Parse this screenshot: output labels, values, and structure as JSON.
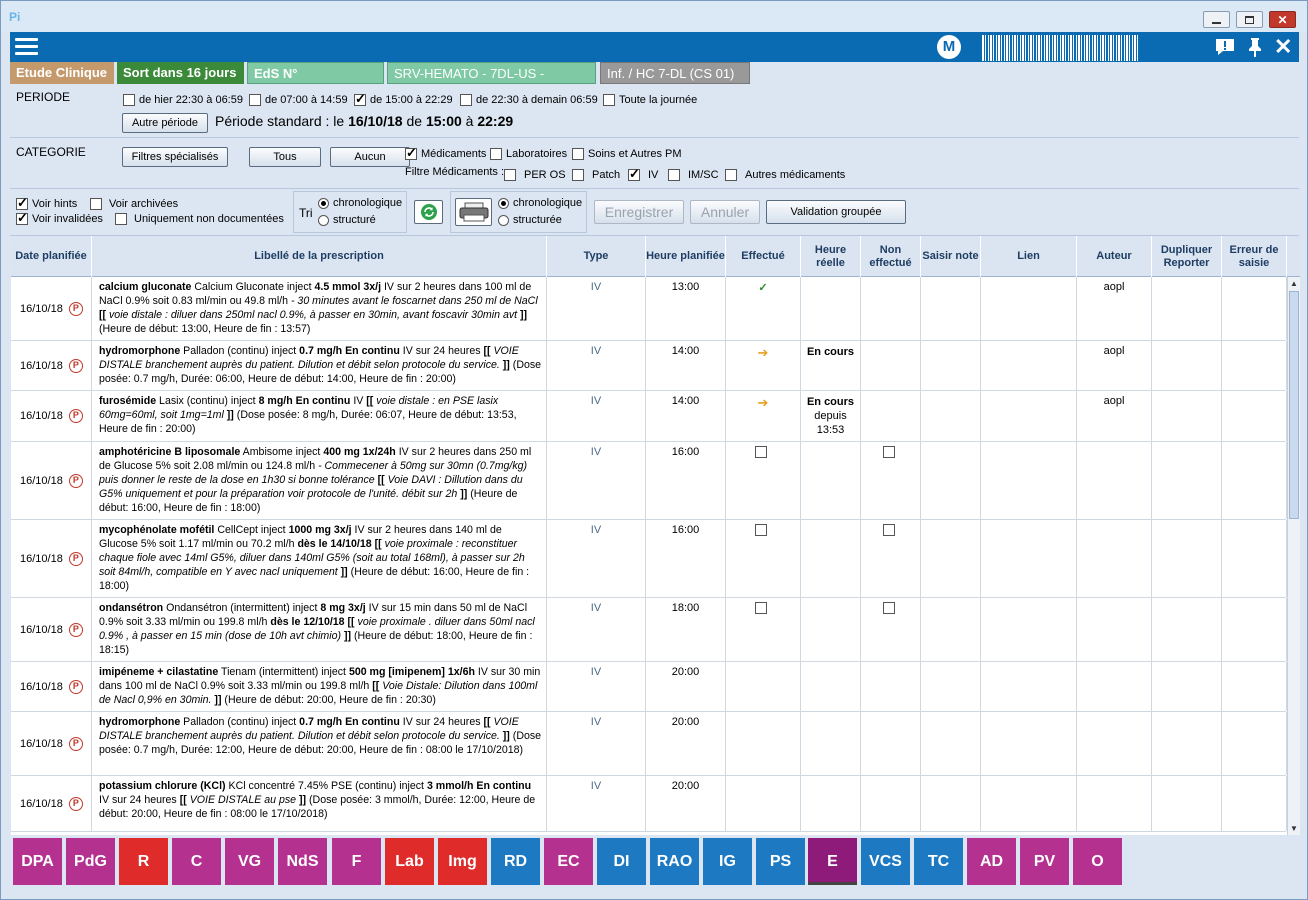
{
  "window": {
    "app_title": "Pi"
  },
  "tags": {
    "etude": "Etude Clinique",
    "sort": "Sort dans 16 jours",
    "eds": "EdS N°",
    "service": "SRV-HEMATO - 7DL-US -",
    "inf": "Inf. / HC 7-DL (CS 01)"
  },
  "header": {
    "user_initial": "M"
  },
  "periode": {
    "label": "PERIODE",
    "options": [
      {
        "label": "de hier 22:30 à 06:59",
        "checked": false
      },
      {
        "label": "de 07:00 à 14:59",
        "checked": false
      },
      {
        "label": "de 15:00 à 22:29",
        "checked": true
      },
      {
        "label": "de 22:30 à demain 06:59",
        "checked": false
      },
      {
        "label": "Toute la journée",
        "checked": false
      }
    ],
    "autre_btn": "Autre période",
    "std_prefix": "Période standard :  le ",
    "std_date": "16/10/18",
    "std_de": " de ",
    "std_start": "15:00",
    "std_a": " à ",
    "std_end": "22:29"
  },
  "categorie": {
    "label": "CATEGORIE",
    "btn_filtres": "Filtres spécialisés",
    "btn_tous": "Tous",
    "btn_aucun": "Aucun",
    "cat_options": [
      {
        "label": "Médicaments",
        "checked": true
      },
      {
        "label": "Laboratoires",
        "checked": false
      },
      {
        "label": "Soins et Autres PM",
        "checked": false
      }
    ],
    "filtre_label": "Filtre Médicaments :",
    "med_options": [
      {
        "label": "PER OS",
        "checked": false
      },
      {
        "label": "Patch",
        "checked": false
      },
      {
        "label": "IV",
        "checked": true
      },
      {
        "label": "IM/SC",
        "checked": false
      },
      {
        "label": "Autres médicaments",
        "checked": false
      }
    ]
  },
  "options": {
    "voir_hints": "Voir hints",
    "voir_archivees": "Voir archivées",
    "voir_invalidees": "Voir invalidées",
    "non_documentees": "Uniquement non documentées",
    "tri": "Tri",
    "chrono": "chronologique",
    "structure": "structuré",
    "chrono2": "chronologique",
    "structuree": "structurée",
    "enregistrer": "Enregistrer",
    "annuler": "Annuler",
    "validation": "Validation groupée"
  },
  "columns": [
    "Date planifiée",
    "Libellé de la prescription",
    "Type",
    "Heure planifiée",
    "Effectué",
    "Heure réelle",
    "Non effectué",
    "Saisir note",
    "Lien",
    "Auteur",
    "Dupliquer Reporter",
    "Erreur de saisie"
  ],
  "rows": [
    {
      "date": "16/10/18",
      "parts": [
        [
          "b",
          "calcium gluconate"
        ],
        [
          "n",
          " Calcium Gluconate inject  "
        ],
        [
          "b",
          "4.5 mmol  3x/j"
        ],
        [
          "n",
          " IV sur 2 heures dans 100 ml de NaCl 0.9% soit 0.83 ml/min ou 49.8 ml/h  "
        ],
        [
          "i",
          "- 30 minutes avant le foscarnet dans 250 ml de NaCl "
        ],
        [
          "b",
          "[["
        ],
        [
          "i",
          " voie distale : diluer dans 250ml nacl 0.9%, à passer en 30min, avant foscavir 30min avt "
        ],
        [
          "b",
          "]]"
        ],
        [
          "n",
          "  (Heure de début: 13:00, Heure de fin : 13:57)"
        ]
      ],
      "type": "IV",
      "heure": "13:00",
      "effectue": "check",
      "reelle": "",
      "reelle2": "",
      "non": false,
      "auteur": "aopl"
    },
    {
      "date": "16/10/18",
      "parts": [
        [
          "b",
          "hydromorphone"
        ],
        [
          "n",
          " Palladon (continu) inject  "
        ],
        [
          "b",
          "0.7 mg/h  En continu"
        ],
        [
          "n",
          " IV sur 24 heures "
        ],
        [
          "b",
          "[["
        ],
        [
          "i",
          " VOIE DISTALE branchement auprès du patient. Dilution et débit selon protocole du service. "
        ],
        [
          "b",
          "]]"
        ],
        [
          "n",
          " (Dose posée: 0.7 mg/h, Durée: 06:00, Heure de début: 14:00, Heure de fin : 20:00)"
        ]
      ],
      "type": "IV",
      "heure": "14:00",
      "effectue": "arrow",
      "reelle": "En cours",
      "reelle2": "",
      "non": false,
      "auteur": "aopl"
    },
    {
      "date": "16/10/18",
      "parts": [
        [
          "b",
          "furosémide"
        ],
        [
          "n",
          " Lasix (continu) inject  "
        ],
        [
          "b",
          "8 mg/h  En continu"
        ],
        [
          "n",
          " IV "
        ],
        [
          "b",
          "[["
        ],
        [
          "i",
          " voie distale : en PSE lasix 60mg=60ml, soit 1mg=1ml "
        ],
        [
          "b",
          "]]"
        ],
        [
          "n",
          "  (Dose posée: 8 mg/h, Durée: 06:07, Heure de début: 13:53, Heure de fin : 20:00)"
        ]
      ],
      "type": "IV",
      "heure": "14:00",
      "effectue": "arrow",
      "reelle": "En cours",
      "reelle2": "depuis 13:53",
      "non": false,
      "auteur": "aopl"
    },
    {
      "date": "16/10/18",
      "parts": [
        [
          "b",
          "amphotéricine B liposomale"
        ],
        [
          "n",
          " Ambisome inject  "
        ],
        [
          "b",
          "400 mg  1x/24h"
        ],
        [
          "n",
          " IV sur 2 heures dans 250 ml de Glucose 5% soit 2.08 ml/min ou 124.8 ml/h  "
        ],
        [
          "i",
          "- Commecener à 50mg sur 30mn (0.7mg/kg) puis donner le reste de la dose en 1h30 si bonne tolérance "
        ],
        [
          "b",
          "[["
        ],
        [
          "i",
          " Voie DAVI : Dillution dans du G5% uniquement et pour la préparation voir protocole de l'unité. débit sur 2h "
        ],
        [
          "b",
          "]]"
        ],
        [
          "n",
          "  (Heure de début: 16:00, Heure de fin : 18:00)"
        ]
      ],
      "type": "IV",
      "heure": "16:00",
      "effectue": "box",
      "reelle": "",
      "reelle2": "",
      "non": true,
      "auteur": ""
    },
    {
      "date": "16/10/18",
      "parts": [
        [
          "b",
          "mycophénolate mofétil"
        ],
        [
          "n",
          " CellCept inject  "
        ],
        [
          "b",
          "1000 mg  3x/j"
        ],
        [
          "n",
          " IV sur 2 heures dans 140 ml de Glucose 5% soit 1.17 ml/min ou 70.2 ml/h  "
        ],
        [
          "b",
          "dès le 14/10/18 [["
        ],
        [
          "i",
          " voie proximale : reconstituer chaque fiole avec 14ml G5%, diluer dans 140ml G5% (soit au total 168ml), à passer sur 2h soit 84ml/h, compatible en Y avec nacl uniquement "
        ],
        [
          "b",
          "]]"
        ],
        [
          "n",
          "  (Heure de début: 16:00, Heure de fin : 18:00)"
        ]
      ],
      "type": "IV",
      "heure": "16:00",
      "effectue": "box",
      "reelle": "",
      "reelle2": "",
      "non": true,
      "auteur": ""
    },
    {
      "date": "16/10/18",
      "parts": [
        [
          "b",
          "ondansétron"
        ],
        [
          "n",
          " Ondansétron (intermittent) inject  "
        ],
        [
          "b",
          "8 mg  3x/j"
        ],
        [
          "n",
          " IV sur 15 min dans 50 ml de NaCl 0.9% soit 3.33 ml/min ou 199.8 ml/h  "
        ],
        [
          "b",
          "dès le 12/10/18 [["
        ],
        [
          "i",
          " voie proximale . diluer dans 50ml nacl 0.9% , à passer en 15 min (dose de 10h avt chimio) "
        ],
        [
          "b",
          "]]"
        ],
        [
          "n",
          "  (Heure de début: 18:00, Heure de fin : 18:15)"
        ]
      ],
      "type": "IV",
      "heure": "18:00",
      "effectue": "box",
      "reelle": "",
      "reelle2": "",
      "non": true,
      "auteur": ""
    },
    {
      "date": "16/10/18",
      "parts": [
        [
          "b",
          "imipéneme + cilastatine"
        ],
        [
          "n",
          " Tienam (intermittent) inject  "
        ],
        [
          "b",
          "500 mg [imipenem]  1x/6h"
        ],
        [
          "n",
          " IV sur 30 min dans 100 ml de NaCl 0.9% soit 3.33 ml/min ou 199.8 ml/h "
        ],
        [
          "b",
          "[["
        ],
        [
          "i",
          " Voie Distale: Dilution dans 100ml de Nacl 0,9% en 30min. "
        ],
        [
          "b",
          "]]"
        ],
        [
          "n",
          "  (Heure de début: 20:00, Heure de fin : 20:30)"
        ]
      ],
      "type": "IV",
      "heure": "20:00",
      "effectue": "",
      "reelle": "",
      "reelle2": "",
      "non": false,
      "auteur": ""
    },
    {
      "date": "16/10/18",
      "parts": [
        [
          "b",
          "hydromorphone"
        ],
        [
          "n",
          " Palladon (continu) inject  "
        ],
        [
          "b",
          "0.7 mg/h  En continu"
        ],
        [
          "n",
          " IV sur 24 heures "
        ],
        [
          "b",
          "[["
        ],
        [
          "i",
          " VOIE DISTALE branchement auprès du patient. Dilution et débit selon protocole du service. "
        ],
        [
          "b",
          "]]"
        ],
        [
          "n",
          " (Dose posée: 0.7 mg/h, Durée: 12:00, Heure de début: 20:00, Heure de fin : 08:00 le 17/10/2018)"
        ]
      ],
      "type": "IV",
      "heure": "20:00",
      "effectue": "",
      "reelle": "",
      "reelle2": "",
      "non": false,
      "auteur": ""
    },
    {
      "date": "16/10/18",
      "parts": [
        [
          "b",
          "potassium chlorure (KCl)"
        ],
        [
          "n",
          " KCl concentré 7.45% PSE (continu) inject  "
        ],
        [
          "b",
          "3 mmol/h  En continu"
        ],
        [
          "n",
          " IV sur 24 heures "
        ],
        [
          "b",
          "[["
        ],
        [
          "i",
          " VOIE DISTALE au pse "
        ],
        [
          "b",
          "]]"
        ],
        [
          "n",
          "  (Dose posée: 3 mmol/h, Durée: 12:00, Heure de début: 20:00, Heure de fin : 08:00 le 17/10/2018)"
        ]
      ],
      "type": "IV",
      "heure": "20:00",
      "effectue": "",
      "reelle": "",
      "reelle2": "",
      "non": false,
      "auteur": ""
    }
  ],
  "nav": [
    {
      "label": "DPA",
      "color": "#b5318f"
    },
    {
      "label": "PdG",
      "color": "#b5318f"
    },
    {
      "label": "R",
      "color": "#e02b2b"
    },
    {
      "label": "C",
      "color": "#b5318f"
    },
    {
      "label": "VG",
      "color": "#b5318f"
    },
    {
      "label": "NdS",
      "color": "#b5318f"
    },
    {
      "label": "F",
      "color": "#b5318f"
    },
    {
      "label": "Lab",
      "color": "#e02b2b"
    },
    {
      "label": "Img",
      "color": "#e02b2b"
    },
    {
      "label": "RD",
      "color": "#1d79c2"
    },
    {
      "label": "EC",
      "color": "#b5318f"
    },
    {
      "label": "DI",
      "color": "#1d79c2"
    },
    {
      "label": "RAO",
      "color": "#1d79c2"
    },
    {
      "label": "IG",
      "color": "#1d79c2"
    },
    {
      "label": "PS",
      "color": "#1d79c2"
    },
    {
      "label": "E",
      "color": "#8e1a7a"
    },
    {
      "label": "VCS",
      "color": "#1d79c2"
    },
    {
      "label": "TC",
      "color": "#1d79c2"
    },
    {
      "label": "AD",
      "color": "#b5318f"
    },
    {
      "label": "PV",
      "color": "#b5318f"
    },
    {
      "label": "O",
      "color": "#b5318f"
    }
  ],
  "nav_selected": "E"
}
